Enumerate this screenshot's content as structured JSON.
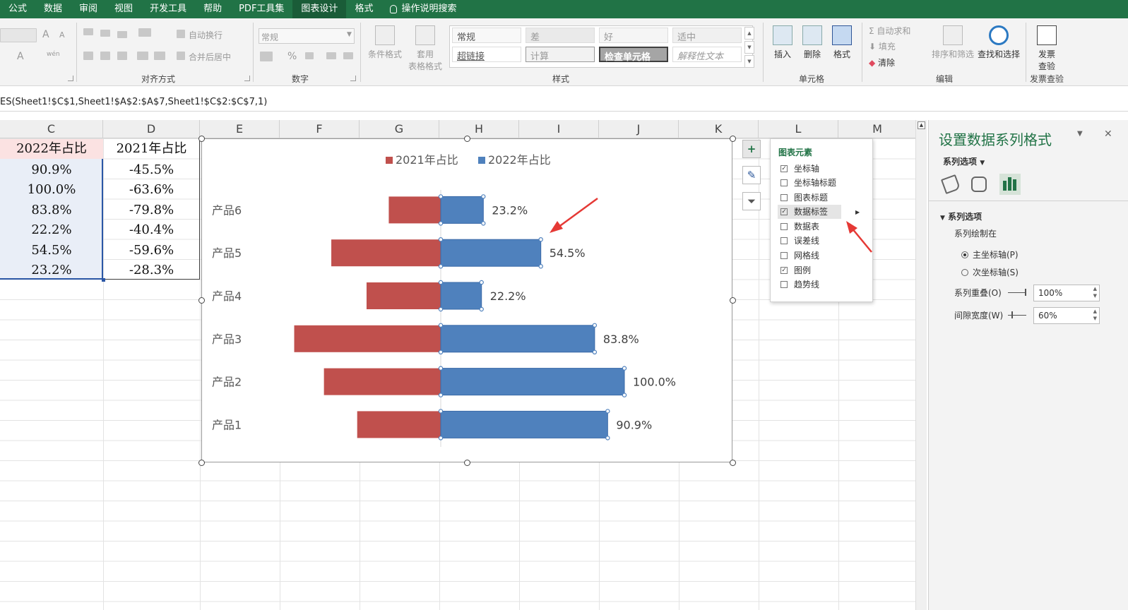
{
  "menu": {
    "items": [
      "公式",
      "数据",
      "审阅",
      "视图",
      "开发工具",
      "帮助",
      "PDF工具集",
      "图表设计",
      "格式"
    ],
    "active_index": 7,
    "search": "操作说明搜索"
  },
  "ribbon": {
    "font": {
      "increase": "A",
      "decrease": "A",
      "font_color": "A",
      "phonetic": "wén"
    },
    "alignment": {
      "wrap": "自动换行",
      "merge": "合并后居中",
      "label": "对齐方式"
    },
    "number": {
      "format": "常规",
      "percent": "%",
      "label": "数字"
    },
    "styles": {
      "conditional": "条件格式",
      "table_format_1": "套用",
      "table_format_2": "表格格式",
      "cells": [
        "常规",
        "差",
        "好",
        "适中",
        "超链接",
        "计算",
        "检查单元格",
        "解释性文本"
      ],
      "label": "样式"
    },
    "cells_group": {
      "insert": "插入",
      "delete": "删除",
      "format": "格式",
      "label": "单元格"
    },
    "editing": {
      "autosum": "自动求和",
      "fill": "填充",
      "clear": "清除",
      "sort": "排序和筛选",
      "find": "查找和选择",
      "label": "编辑"
    },
    "invoice": {
      "line1": "发票",
      "line2": "查验",
      "label": "发票查验"
    }
  },
  "formula": "ES(Sheet1!$C$1,Sheet1!$A$2:$A$7,Sheet1!$C$2:$C$7,1)",
  "columns": [
    "C",
    "D",
    "E",
    "F",
    "G",
    "H",
    "I",
    "J",
    "K",
    "L",
    "M"
  ],
  "table": {
    "header_c": "2022年占比",
    "header_d": "2021年占比",
    "col_c": [
      "90.9%",
      "100.0%",
      "83.8%",
      "22.2%",
      "54.5%",
      "23.2%"
    ],
    "col_d": [
      "-45.5%",
      "-63.6%",
      "-79.8%",
      "-40.4%",
      "-59.6%",
      "-28.3%"
    ]
  },
  "chart_data": {
    "type": "bar",
    "orientation": "horizontal",
    "categories": [
      "产品1",
      "产品2",
      "产品3",
      "产品4",
      "产品5",
      "产品6"
    ],
    "series": [
      {
        "name": "2021年占比",
        "values": [
          -45.5,
          -63.6,
          -79.8,
          -40.4,
          -59.6,
          -28.3
        ],
        "color": "#c0504d"
      },
      {
        "name": "2022年占比",
        "values": [
          90.9,
          100.0,
          83.8,
          22.2,
          54.5,
          23.2
        ],
        "color": "#4f81bd"
      }
    ],
    "data_labels": [
      "90.9%",
      "100.0%",
      "83.8%",
      "22.2%",
      "54.5%",
      "23.2%"
    ],
    "xlim": [
      -100,
      100
    ],
    "legend": "top",
    "grid": false
  },
  "chart_elements_popup": {
    "title": "图表元素",
    "items": [
      {
        "label": "坐标轴",
        "checked": true
      },
      {
        "label": "坐标轴标题",
        "checked": false
      },
      {
        "label": "图表标题",
        "checked": false
      },
      {
        "label": "数据标签",
        "checked": true
      },
      {
        "label": "数据表",
        "checked": false
      },
      {
        "label": "误差线",
        "checked": false
      },
      {
        "label": "网格线",
        "checked": false
      },
      {
        "label": "图例",
        "checked": true
      },
      {
        "label": "趋势线",
        "checked": false
      }
    ]
  },
  "format_pane": {
    "title": "设置数据系列格式",
    "options_dropdown": "系列选项",
    "section": "系列选项",
    "plot_on": "系列绘制在",
    "primary": "主坐标轴(P)",
    "secondary": "次坐标轴(S)",
    "overlap_label": "系列重叠(O)",
    "overlap_value": "100%",
    "gap_label": "间隙宽度(W)",
    "gap_value": "60%"
  },
  "colors": {
    "excel_green": "#217346",
    "arrow_red": "#e53935"
  }
}
